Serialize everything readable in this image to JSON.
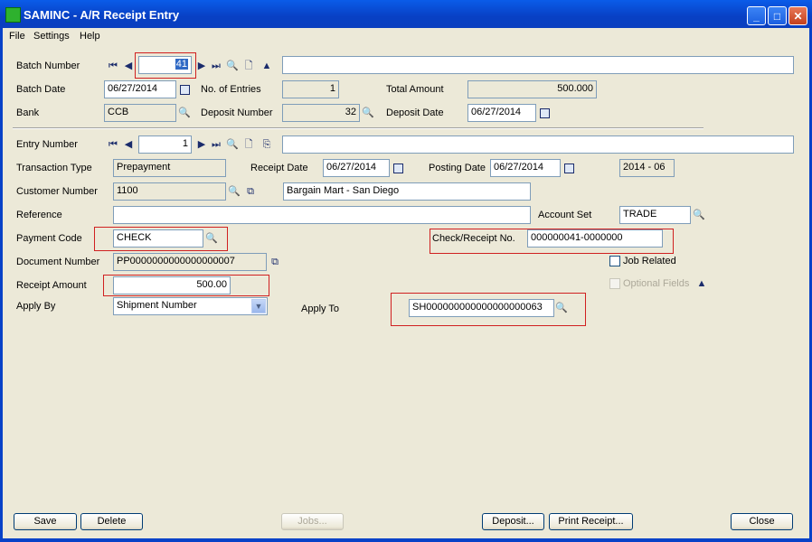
{
  "window": {
    "title": "SAMINC - A/R Receipt Entry",
    "min_glyph": "_",
    "max_glyph": "□",
    "close_glyph": "✕"
  },
  "menu": [
    "File",
    "Settings",
    "Help"
  ],
  "nav_glyphs": {
    "first": "⏮",
    "prev": "◀",
    "next": "▶",
    "last": "⏭",
    "finder": "🔍",
    "new": "🗋",
    "up": "▲",
    "print": "⎘",
    "zoom": "⧉"
  },
  "batch": {
    "number_label": "Batch Number",
    "number": "41",
    "description": "",
    "date_label": "Batch Date",
    "date": "06/27/2014",
    "entries_label": "No. of Entries",
    "entries": "1",
    "total_label": "Total Amount",
    "total": "500.000",
    "bank_label": "Bank",
    "bank": "CCB",
    "deposit_number_label": "Deposit Number",
    "deposit_number": "32",
    "deposit_date_label": "Deposit Date",
    "deposit_date": "06/27/2014"
  },
  "entry": {
    "number_label": "Entry Number",
    "number": "1",
    "description": "",
    "transaction_type_label": "Transaction Type",
    "transaction_type": "Prepayment",
    "receipt_date_label": "Receipt Date",
    "receipt_date": "06/27/2014",
    "posting_date_label": "Posting Date",
    "posting_date": "06/27/2014",
    "period": "2014 - 06",
    "customer_label": "Customer Number",
    "customer": "1100",
    "customer_name": "Bargain Mart - San Diego",
    "reference_label": "Reference",
    "reference": "",
    "account_set_label": "Account Set",
    "account_set": "TRADE",
    "payment_code_label": "Payment Code",
    "payment_code": "CHECK",
    "check_label": "Check/Receipt No.",
    "check_no": "000000041-0000000",
    "document_label": "Document Number",
    "document": "PP0000000000000000007",
    "job_related_label": "Job Related",
    "receipt_amount_label": "Receipt Amount",
    "receipt_amount": "500.00",
    "optional_fields_label": "Optional Fields",
    "apply_by_label": "Apply By",
    "apply_by": "Shipment Number",
    "apply_to_label": "Apply To",
    "apply_to": "SH000000000000000000063"
  },
  "buttons": {
    "save": "Save",
    "delete": "Delete",
    "jobs": "Jobs...",
    "deposit": "Deposit...",
    "print_receipt": "Print Receipt...",
    "close": "Close"
  }
}
